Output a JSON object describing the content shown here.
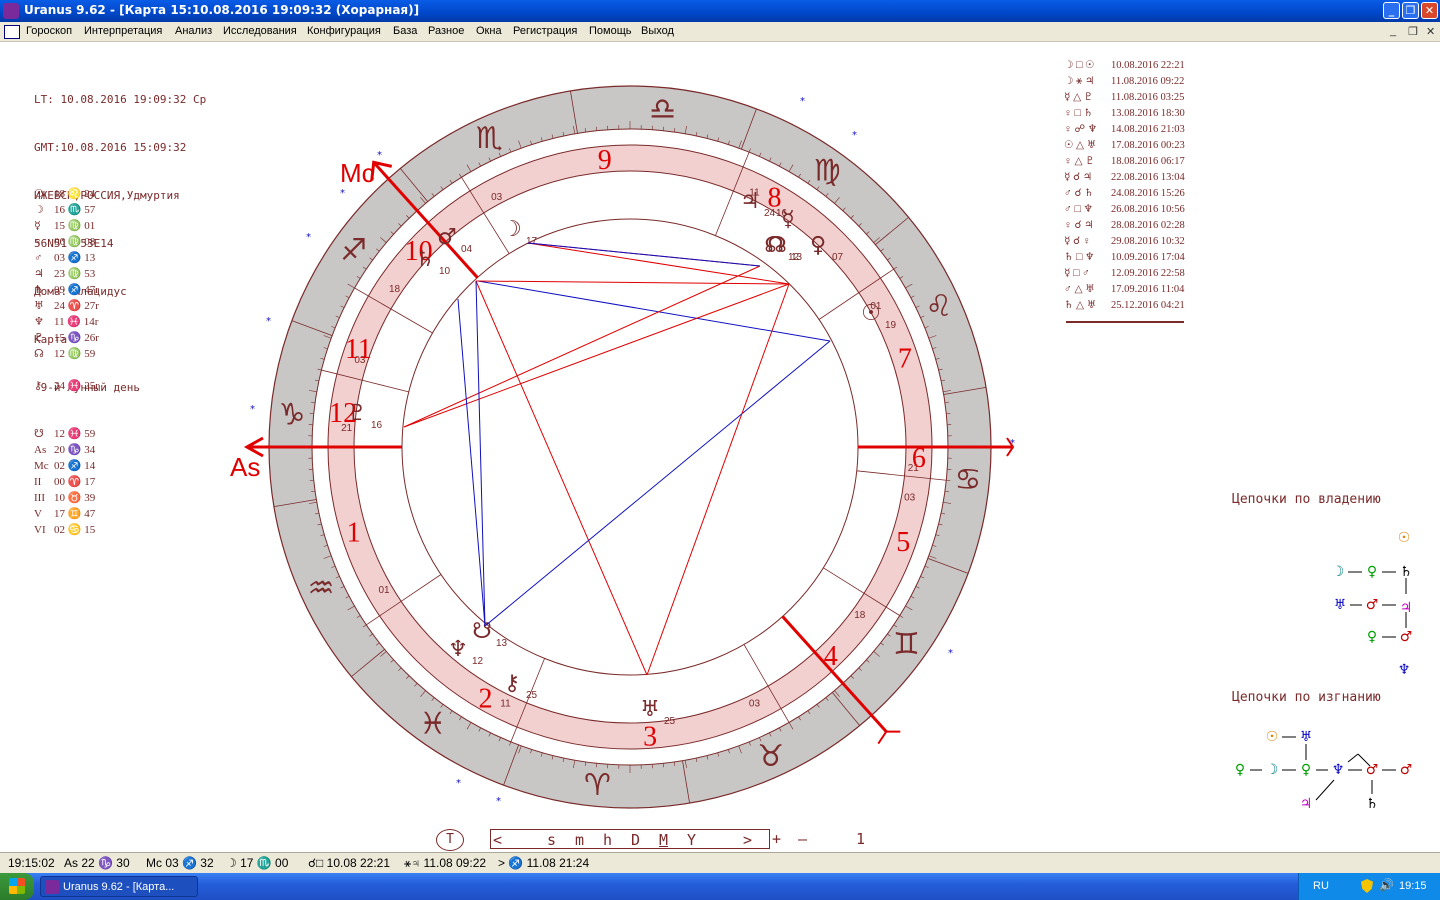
{
  "window": {
    "title": "Uranus 9.62 - [Карта 15:10.08.2016 19:09:32 (Хорарная)]",
    "minimize": "_",
    "restore": "❐",
    "close": "✕"
  },
  "menu": {
    "items": [
      "Гороскоп",
      "Интерпретация",
      "Анализ",
      "Исследования",
      "Конфигурация",
      "База",
      "Разное",
      "Окна",
      "Регистрация",
      "Помощь",
      "Выход"
    ],
    "mdi_minimize": "_",
    "mdi_restore": "❐",
    "mdi_close": "✕"
  },
  "info": {
    "lines": [
      "LT: 10.08.2016 19:09:32 Ср",
      "GMT:10.08.2016 15:09:32",
      "ИЖЕВСК,РОССИЯ,Удмуртия",
      "56N51  53E14",
      "Дома: Плацидус",
      "Карта",
      " 9-й лунный день"
    ]
  },
  "planets": [
    {
      "glyph": "☉",
      "value": "18 ♌ 24"
    },
    {
      "glyph": "☽",
      "value": "16 ♏ 57"
    },
    {
      "glyph": "☿",
      "value": "15 ♍ 01"
    },
    {
      "glyph": "♀",
      "value": "06 ♍ 08"
    },
    {
      "glyph": "♂",
      "value": "03 ♐ 13"
    },
    {
      "glyph": "♃",
      "value": "23 ♍ 53"
    },
    {
      "glyph": "♄",
      "value": "09 ♐ 47r"
    },
    {
      "glyph": "♅",
      "value": "24 ♈ 27r"
    },
    {
      "glyph": "♆",
      "value": "11 ♓ 14r"
    },
    {
      "glyph": "♇",
      "value": "15 ♑ 26r"
    },
    {
      "glyph": "☊",
      "value": "12 ♍ 59"
    }
  ],
  "chiron": {
    "glyph": "⚷",
    "value": "24 ♓ 25r"
  },
  "angles": [
    {
      "glyph": "☋",
      "value": "12 ♓ 59"
    },
    {
      "glyph": "As",
      "value": "20 ♑ 34"
    },
    {
      "glyph": "Mc",
      "value": "02 ♐ 14"
    },
    {
      "glyph": "II",
      "value": "00 ♈ 17"
    },
    {
      "glyph": "III",
      "value": "10 ♉ 39"
    },
    {
      "glyph": "V",
      "value": "17 ♊ 47"
    },
    {
      "glyph": "VI",
      "value": "02 ♋ 15"
    }
  ],
  "aspects": [
    {
      "glyph": "☽ □ ☉",
      "date": "10.08.2016 22:21"
    },
    {
      "glyph": "☽ ⚹ ♃",
      "date": "11.08.2016 09:22"
    },
    {
      "glyph": "☿ △ ♇",
      "date": "11.08.2016 03:25"
    },
    {
      "glyph": "♀ □ ♄",
      "date": "13.08.2016 18:30"
    },
    {
      "glyph": "♀ ☍ ♆",
      "date": "14.08.2016 21:03"
    },
    {
      "glyph": "☉ △ ♅",
      "date": "17.08.2016 00:23"
    },
    {
      "glyph": "♀ △ ♇",
      "date": "18.08.2016 06:17"
    },
    {
      "glyph": "☿ ☌ ♃",
      "date": "22.08.2016 13:04"
    },
    {
      "glyph": "♂ ☌ ♄",
      "date": "24.08.2016 15:26"
    },
    {
      "glyph": "♂ □ ♆",
      "date": "26.08.2016 10:56"
    },
    {
      "glyph": "♀ ☌ ♃",
      "date": "28.08.2016 02:28"
    },
    {
      "glyph": "☿ ☌ ♀",
      "date": "29.08.2016 10:32"
    },
    {
      "glyph": "♄ □ ♆",
      "date": "10.09.2016 17:04"
    },
    {
      "glyph": "☿ □ ♂",
      "date": "12.09.2016 22:58"
    },
    {
      "glyph": "♂ △ ♅",
      "date": "17.09.2016 11:04"
    },
    {
      "glyph": "♄ △ ♅",
      "date": "25.12.2016 04:21"
    }
  ],
  "chart": {
    "mc_label": "Mc",
    "as_label": "As",
    "house_numbers": [
      "1",
      "2",
      "3",
      "4",
      "5",
      "6",
      "7",
      "8",
      "9",
      "10",
      "11",
      "12"
    ],
    "sign_glyphs": [
      "♑",
      "♒",
      "♓",
      "♈",
      "♉",
      "♊",
      "♋",
      "♌",
      "♍",
      "♎",
      "♏",
      "♐"
    ],
    "cusp_degrees": [
      "21",
      "01",
      "11",
      "03",
      "18",
      "03",
      "21",
      "01",
      "11",
      "03",
      "18",
      "03"
    ],
    "planets_on_wheel": [
      {
        "glyph": "☉",
        "deg": "19"
      },
      {
        "glyph": "☽",
        "deg": "17"
      },
      {
        "glyph": "☿",
        "deg": "16"
      },
      {
        "glyph": "♀",
        "deg": "07"
      },
      {
        "glyph": "♂",
        "deg": "04"
      },
      {
        "glyph": "♃",
        "deg": "24"
      },
      {
        "glyph": "♄",
        "deg": "10"
      },
      {
        "glyph": "♅",
        "deg": "25"
      },
      {
        "glyph": "♆",
        "deg": "12"
      },
      {
        "glyph": "♇",
        "deg": "16"
      },
      {
        "glyph": "☊",
        "deg": "13"
      },
      {
        "glyph": "☋",
        "deg": "13"
      },
      {
        "glyph": "⚷",
        "deg": "25"
      },
      {
        "glyph": "☊",
        "deg": "12"
      }
    ],
    "colors": {
      "ring": "#7a2a2a",
      "red": "#e00000",
      "blue": "#1010c0",
      "ring_fill": "#f2d0d0"
    }
  },
  "chains": {
    "ownership_title": "Цепочки по владению",
    "exile_title": "Цепочки по изгнанию",
    "ownership_glyphs": [
      "☉",
      "☽",
      "♀",
      "♄",
      "♅",
      "♂",
      "♃",
      "♀",
      "♂",
      "♆"
    ],
    "exile_glyphs": [
      "☉",
      "♅",
      "♀",
      "☽",
      "♀",
      "♆",
      "♂",
      "♂",
      "♃",
      "♄"
    ]
  },
  "timebar": {
    "t_button": "T",
    "left_arrow": "<",
    "units": [
      "s",
      "m",
      "h",
      "D",
      "M",
      "Y"
    ],
    "right_arrow": ">",
    "plus": "+",
    "minus": "–",
    "step": "1"
  },
  "status": {
    "time": "19:15:02",
    "asc": "As 22 ♑ 30",
    "mc": "Mc 03 ♐ 32",
    "moon": "☽ 17 ♏ 00",
    "aspect1": "☌□ 10.08 22:21",
    "aspect2": "⚹♃ 11.08 09:22",
    "aspect3": "> ♐ 11.08 21:24"
  },
  "taskbar": {
    "task_label": "Uranus 9.62 - [Карта...",
    "lang": "RU",
    "clock": "19:15"
  }
}
